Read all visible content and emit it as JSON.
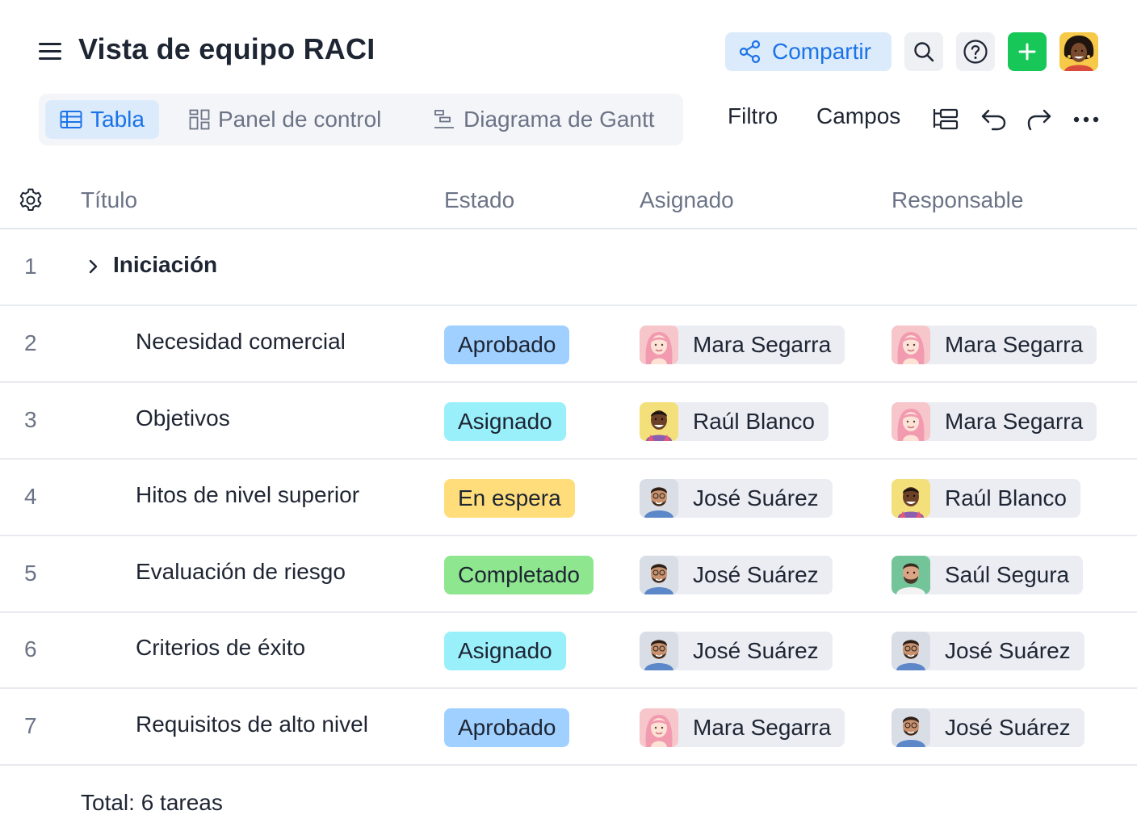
{
  "header": {
    "title": "Vista de equipo RACI",
    "share_label": "Compartir"
  },
  "views": [
    {
      "label": "Tabla",
      "active": true
    },
    {
      "label": "Panel de control",
      "active": false
    },
    {
      "label": "Diagrama de Gantt",
      "active": false
    }
  ],
  "toolbar": {
    "filter_label": "Filtro",
    "fields_label": "Campos"
  },
  "columns": {
    "title": "Título",
    "status": "Estado",
    "assignee": "Asignado",
    "owner": "Responsable"
  },
  "group": {
    "num": "1",
    "title": "Iniciación"
  },
  "rows": [
    {
      "num": "2",
      "title": "Necesidad comercial",
      "status": "Aprobado",
      "assignee": "Mara Segarra",
      "owner": "Mara Segarra"
    },
    {
      "num": "3",
      "title": "Objetivos",
      "status": "Asignado",
      "assignee": "Raúl Blanco",
      "owner": "Mara Segarra"
    },
    {
      "num": "4",
      "title": "Hitos de nivel superior",
      "status": "En espera",
      "assignee": "José Suárez",
      "owner": "Raúl Blanco"
    },
    {
      "num": "5",
      "title": "Evaluación de riesgo",
      "status": "Completado",
      "assignee": "José Suárez",
      "owner": "Saúl Segura"
    },
    {
      "num": "6",
      "title": "Criterios de éxito",
      "status": "Asignado",
      "assignee": "José Suárez",
      "owner": "José Suárez"
    },
    {
      "num": "7",
      "title": "Requisitos de alto nivel",
      "status": "Aprobado",
      "assignee": "Mara Segarra",
      "owner": "José Suárez"
    }
  ],
  "footer": {
    "total": "Total: 6 tareas"
  },
  "colors": {
    "accent": "#1a73e8",
    "add_button": "#17c758",
    "status_aprobado": "#9fd0ff",
    "status_asignado": "#9af0fa",
    "status_en_espera": "#ffdd7a",
    "status_completado": "#8ee68f"
  },
  "icons": [
    "menu-icon",
    "share-icon",
    "search-icon",
    "help-icon",
    "plus-icon",
    "table-icon",
    "dashboard-icon",
    "gantt-icon",
    "hierarchy-icon",
    "undo-icon",
    "redo-icon",
    "more-icon",
    "gear-icon",
    "chevron-right-icon"
  ]
}
